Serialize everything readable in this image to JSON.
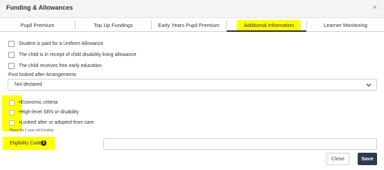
{
  "dialog": {
    "title": "Funding & Allowances",
    "close_glyph": "×"
  },
  "tabs": [
    {
      "label": "Pupil Premium"
    },
    {
      "label": "Top Up Fundings"
    },
    {
      "label": "Early Years Pupil Premium"
    },
    {
      "label": "Additional Information",
      "active": true
    },
    {
      "label": "Learner Monitoring"
    }
  ],
  "checkboxes": [
    {
      "label": "Student is paid for a Uniform Allowance",
      "checked": false
    },
    {
      "label": "The child is in receipt of child disability living allowance",
      "checked": false
    },
    {
      "label": "The child receives free early education",
      "checked": false
    }
  ],
  "post_lac": {
    "label": "Post looked after Arrangements",
    "value": "Not declared"
  },
  "criteria": [
    {
      "label": "Economic criteria",
      "checked": false
    },
    {
      "label": "High-level SEN or disability",
      "checked": false
    },
    {
      "label": "Looked after or adopted from care",
      "checked": false
    }
  ],
  "criteria_note": "*Basis for 2 year old Funding",
  "eligibility": {
    "label": "Eligibility Code",
    "value": "",
    "placeholder": ""
  },
  "footer": {
    "close_label": "Close",
    "save_label": "Save"
  },
  "colors": {
    "highlight": "#ffff00",
    "save_button": "#2c3a4d",
    "active_tab_underline": "#2b2b2b"
  }
}
